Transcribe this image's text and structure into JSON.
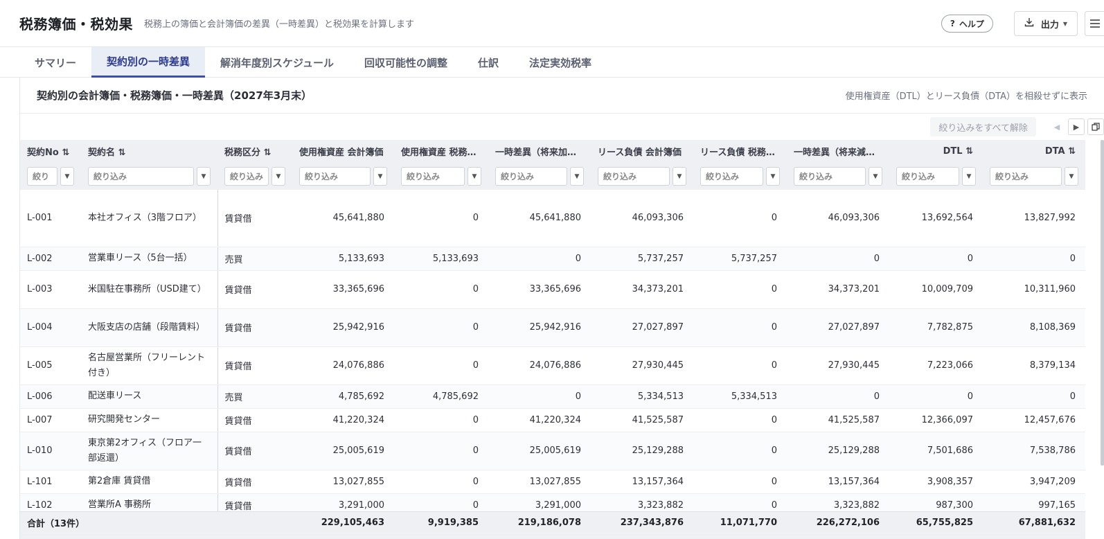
{
  "header": {
    "title": "税務簿価・税効果",
    "subtitle": "税務上の簿価と会計簿価の差異（一時差異）と税効果を計算します",
    "help_icon": "?",
    "help_label": "ヘルプ",
    "export_label": "出力",
    "export_icon": "download-icon",
    "menu_icon": "hamburger-icon"
  },
  "tabs": [
    {
      "label": "サマリー",
      "active": false
    },
    {
      "label": "契約別の一時差異",
      "active": true
    },
    {
      "label": "解消年度別スケジュール",
      "active": false
    },
    {
      "label": "回収可能性の調整",
      "active": false
    },
    {
      "label": "仕訳",
      "active": false
    },
    {
      "label": "法定実効税率",
      "active": false
    }
  ],
  "panel": {
    "title": "契約別の会計簿価・税務簿価・一時差異（2027年3月末）",
    "note": "使用権資産（DTL）とリース負債（DTA）を相殺せずに表示"
  },
  "toolbar": {
    "clear_filters": "絞り込みをすべて解除"
  },
  "columns": [
    {
      "label": "契約No ⇅",
      "placeholder": "絞り"
    },
    {
      "label": "契約名 ⇅",
      "placeholder": "絞り込み"
    },
    {
      "label": "税務区分 ⇅",
      "placeholder": "絞り込み"
    },
    {
      "label": "使用権資産 会計簿価",
      "placeholder": "絞り込み"
    },
    {
      "label": "使用権資産 税務簿価",
      "placeholder": "絞り込み"
    },
    {
      "label": "一時差異（将来加算）",
      "placeholder": "絞り込み"
    },
    {
      "label": "リース負債 会計簿価",
      "placeholder": "絞り込み"
    },
    {
      "label": "リース負債 税務簿価",
      "placeholder": "絞り込み"
    },
    {
      "label": "一時差異（将来減算）",
      "placeholder": "絞り込み"
    },
    {
      "label": "DTL ⇅",
      "placeholder": "絞り込み"
    },
    {
      "label": "DTA ⇅",
      "placeholder": "絞り込み"
    }
  ],
  "rows": [
    [
      "L-001",
      "本社オフィス（3階フロア）",
      "賃貸借",
      "45,641,880",
      "0",
      "45,641,880",
      "46,093,306",
      "0",
      "46,093,306",
      "13,692,564",
      "13,827,992"
    ],
    [
      "L-002",
      "営業車リース（5台一括）",
      "売買",
      "5,133,693",
      "5,133,693",
      "0",
      "5,737,257",
      "5,737,257",
      "0",
      "0",
      "0"
    ],
    [
      "L-003",
      "米国駐在事務所（USD建て）",
      "賃貸借",
      "33,365,696",
      "0",
      "33,365,696",
      "34,373,201",
      "0",
      "34,373,201",
      "10,009,709",
      "10,311,960"
    ],
    [
      "L-004",
      "大阪支店の店舗（段階賃料）",
      "賃貸借",
      "25,942,916",
      "0",
      "25,942,916",
      "27,027,897",
      "0",
      "27,027,897",
      "7,782,875",
      "8,108,369"
    ],
    [
      "L-005",
      "名古屋営業所（フリーレント付き）",
      "賃貸借",
      "24,076,886",
      "0",
      "24,076,886",
      "27,930,445",
      "0",
      "27,930,445",
      "7,223,066",
      "8,379,134"
    ],
    [
      "L-006",
      "配送車リース",
      "売買",
      "4,785,692",
      "4,785,692",
      "0",
      "5,334,513",
      "5,334,513",
      "0",
      "0",
      "0"
    ],
    [
      "L-007",
      "研究開発センター",
      "賃貸借",
      "41,220,324",
      "0",
      "41,220,324",
      "41,525,587",
      "0",
      "41,525,587",
      "12,366,097",
      "12,457,676"
    ],
    [
      "L-010",
      "東京第2オフィス（フロア一部返還）",
      "賃貸借",
      "25,005,619",
      "0",
      "25,005,619",
      "25,129,288",
      "0",
      "25,129,288",
      "7,501,686",
      "7,538,786"
    ],
    [
      "L-101",
      "第2倉庫 賃貸借",
      "賃貸借",
      "13,027,855",
      "0",
      "13,027,855",
      "13,157,364",
      "0",
      "13,157,364",
      "3,908,357",
      "3,947,209"
    ],
    [
      "L-102",
      "営業所A 事務所",
      "賃貸借",
      "3,291,000",
      "0",
      "3,291,000",
      "3,323,882",
      "0",
      "3,323,882",
      "987,300",
      "997,165"
    ]
  ],
  "totals": [
    "合計（13件）",
    "",
    "",
    "229,105,463",
    "9,919,385",
    "219,186,078",
    "237,343,876",
    "11,071,770",
    "226,272,106",
    "65,755,825",
    "67,881,632"
  ]
}
